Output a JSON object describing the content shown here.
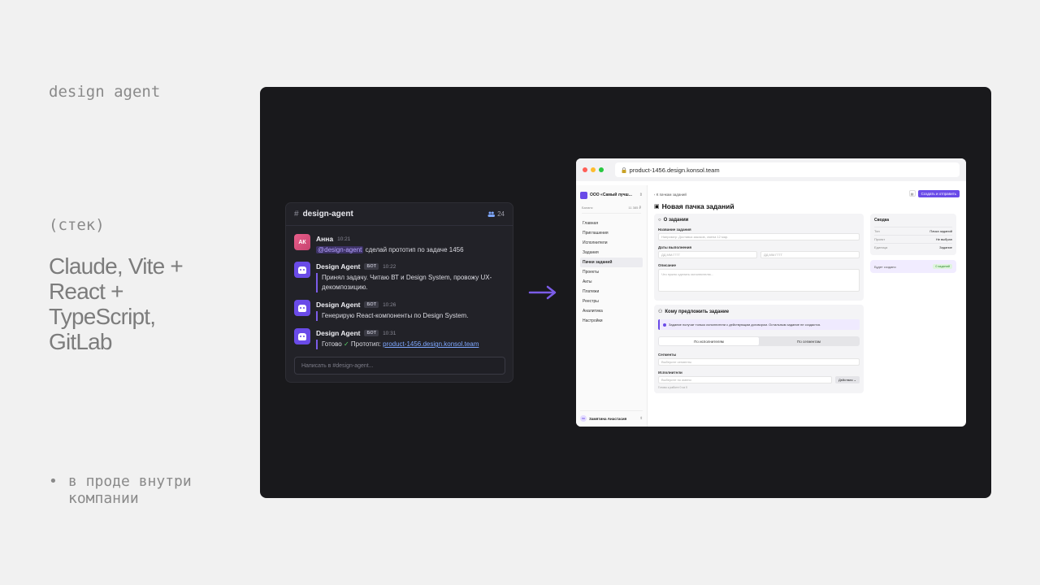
{
  "slide": {
    "tag": "design agent",
    "stack_label": "(стек)",
    "stack_lines": [
      "Claude, Vite +",
      "React +",
      "TypeScript,",
      "GitLab"
    ],
    "bullet_mark": "•",
    "bullet_text_line1": "в проде внутри",
    "bullet_text_line2": "компании"
  },
  "chat": {
    "channel_hash": "#",
    "channel": "design-agent",
    "members_count": "24",
    "messages": [
      {
        "avatar": "АК",
        "author": "Анна",
        "time": "10:21",
        "mention": "@design-agent",
        "text": " сделай прототип по задаче 1456"
      },
      {
        "author": "Design Agent",
        "badge": "БОТ",
        "time": "10:22",
        "text": "Принял задачу. Читаю ВТ и Design System, провожу UX-декомпозицию."
      },
      {
        "author": "Design Agent",
        "badge": "БОТ",
        "time": "10:26",
        "text": "Генерирую React-компоненты по Design System."
      },
      {
        "author": "Design Agent",
        "badge": "БОТ",
        "time": "10:31",
        "text_before": "Готово ",
        "check": "✓",
        "text_mid": " Прототип: ",
        "link": "product-1456.design.konsol.team"
      }
    ],
    "input_placeholder": "Написать в #design-agent..."
  },
  "browser": {
    "url": "product-1456.design.konsol.team",
    "org": "ООО «Самый лучш...",
    "balance_label": "Баланс",
    "balance_value": "11 385 ₽",
    "nav": [
      "Главная",
      "Приглашения",
      "Исполнители",
      "Задания",
      "Пачки заданий",
      "Проекты",
      "Акты",
      "Платежи",
      "Реестры",
      "Аналитика",
      "Настройки"
    ],
    "nav_active_index": 4,
    "user": "Замятина Анастасия",
    "user_initials": "ЗА",
    "breadcrumb": "‹ К пачкам заданий",
    "create_button": "Создать и отправить",
    "page_title": "Новая пачка заданий",
    "about": {
      "title": "О задании",
      "name_label": "Название задания",
      "name_placeholder": "Например: Доставка заказов, смена 12 мар.",
      "dates_label": "Даты выполнения",
      "date_from": "ДД.ММ.ГГГГ",
      "date_to": "ДД.ММ.ГГГГ",
      "desc_label": "Описание",
      "desc_placeholder": "Что нужно сделать исполнителю..."
    },
    "offer": {
      "title": "Кому предложить задание",
      "notice": "Задание получат только исполнители с действующим договором. Остальным задание не создастся.",
      "tab_1": "По исполнителям",
      "tab_2": "По сегментам",
      "segments_label": "Сегменты",
      "segments_placeholder": "Выберите сегменты",
      "executors_label": "Исполнители",
      "executors_placeholder": "Выберите по имени",
      "actions_button": "Действия ⌄",
      "hint": "Готово к работе 0 из 0"
    },
    "summary": {
      "title": "Сводка",
      "rows": [
        {
          "k": "Тип",
          "v": "Пачка заданий"
        },
        {
          "k": "Проект",
          "v": "Не выбран"
        },
        {
          "k": "Единица",
          "v": "Задание"
        }
      ],
      "will_create_label": "Будет создано",
      "will_create_value": "0 заданий"
    }
  },
  "colors": {
    "accent": "#6a4be8",
    "stage_bg": "#19191c",
    "page_bg": "#f1f1f1"
  }
}
